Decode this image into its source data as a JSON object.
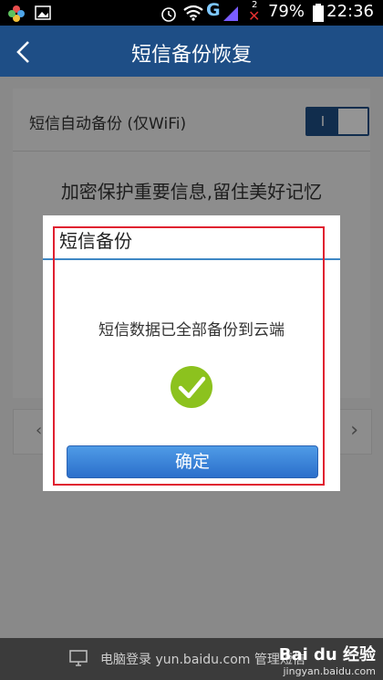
{
  "status_bar": {
    "network": "G",
    "notification_count": "2",
    "battery_percent": "79%",
    "time": "22:36"
  },
  "header": {
    "title": "短信备份恢复"
  },
  "settings": {
    "auto_backup_label": "短信自动备份 (仅WiFi)",
    "toggle_text": "I",
    "tagline": "加密保护重要信息,留住美好记忆"
  },
  "dialog": {
    "title": "短信备份",
    "message": "短信数据已全部备份到云端",
    "ok_label": "确定"
  },
  "footer": {
    "text": "电脑登录 yun.baidu.com 管理短信",
    "watermark": "Bai du 经验",
    "watermark_url": "jingyan.baidu.com"
  },
  "colors": {
    "header_bg": "#1e4e86",
    "accent_blue": "#2b6fcb",
    "success_green": "#8cc21e",
    "highlight_red": "#e02030"
  }
}
